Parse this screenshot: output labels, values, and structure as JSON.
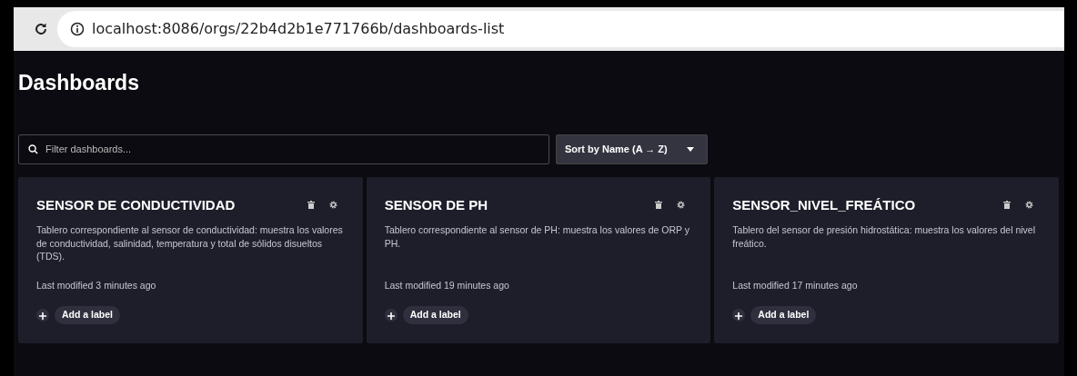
{
  "browser": {
    "url": "localhost:8086/orgs/22b4d2b1e771766b/dashboards-list"
  },
  "page": {
    "title": "Dashboards"
  },
  "filter": {
    "placeholder": "Filter dashboards..."
  },
  "sort": {
    "label": "Sort by Name (A → Z)"
  },
  "dashboards": [
    {
      "name": "SENSOR DE CONDUCTIVIDAD",
      "description": "Tablero correspondiente al sensor de conductividad: muestra los valores de conductividad, salinidad, temperatura y total de sólidos disueltos (TDS).",
      "modified": "Last modified 3 minutes ago",
      "label_button": "Add a label"
    },
    {
      "name": "SENSOR DE PH",
      "description": "Tablero correspondiente al sensor de PH: muestra los valores de ORP y PH.",
      "modified": "Last modified 19 minutes ago",
      "label_button": "Add a label"
    },
    {
      "name": "SENSOR_NIVEL_FREÁTICO",
      "description": "Tablero del sensor de presión hidrostática: muestra los valores del nivel freático.",
      "modified": "Last modified 17 minutes ago",
      "label_button": "Add a label"
    }
  ]
}
